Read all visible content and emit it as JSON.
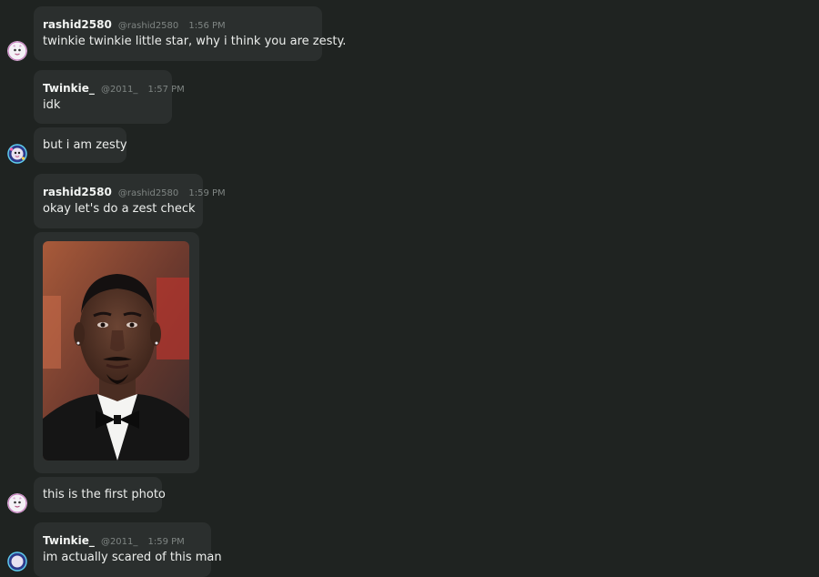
{
  "messages": [
    {
      "username": "rashid2580",
      "handle": "@rashid2580",
      "time": "1:56 PM",
      "text": "twinkie twinkie little star, why i think you are zesty."
    },
    {
      "username": "Twinkie_",
      "handle": "@2011_",
      "time": "1:57 PM",
      "text": "idk",
      "followup": "but i am zesty"
    },
    {
      "username": "rashid2580",
      "handle": "@rashid2580",
      "time": "1:59 PM",
      "text": "okay let's do a zest check",
      "followup": "this is the first photo"
    },
    {
      "username": "Twinkie_",
      "handle": "@2011_",
      "time": "1:59 PM",
      "text": "im actually scared of this man"
    }
  ],
  "icons": {
    "rashid_avatar": "avatar-icon",
    "twinkie_avatar": "avatar-icon"
  },
  "colors": {
    "background": "#1f2321",
    "bubble": "#2b2f2e",
    "username": "#f2f4f2",
    "meta": "#7f8583",
    "text": "#eceeec"
  }
}
